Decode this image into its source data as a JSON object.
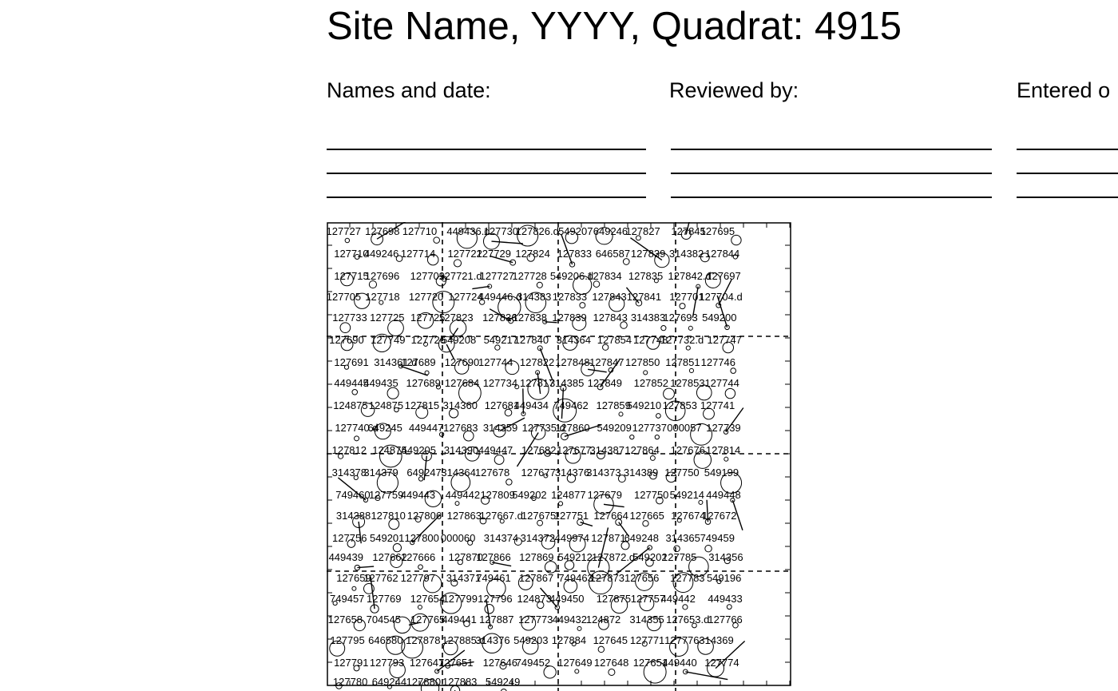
{
  "header": {
    "title": "Site Name, YYYY, Quadrat: 4915"
  },
  "signoff": {
    "names_label": "Names and date:",
    "reviewed_label": "Reviewed by:",
    "entered_label": "Entered o"
  },
  "map": {
    "stroke_color": "#000000",
    "grid": "dashed",
    "labels": [
      "127727",
      "127698",
      "127710",
      "449436.d",
      "127730",
      "127826.d",
      "549207",
      "649246",
      "127827",
      "127845",
      "127695",
      "127710",
      "449246",
      "127714",
      "127722",
      "127729",
      "127824",
      "127833",
      "646587",
      "127839",
      "314382",
      "127844",
      "127715",
      "127696",
      "127709",
      "127721.d",
      "127727",
      "127728",
      "549206.d",
      "127834",
      "127835",
      "127842.d",
      "127697",
      "127705",
      "127718",
      "127720",
      "127724",
      "449446.d",
      "314383",
      "127833",
      "127843",
      "127841",
      "127701",
      "127704.d",
      "127733",
      "127725",
      "127725",
      "127823",
      "127836",
      "127838",
      "127839",
      "127843",
      "314383",
      "127693",
      "549200",
      "127690",
      "127749",
      "127726",
      "549208",
      "549217",
      "127840",
      "314364",
      "127854",
      "127748",
      "127732.d",
      "127747",
      "127691",
      "314361.d",
      "127689",
      "127690",
      "127744",
      "127822",
      "127848",
      "127847",
      "127850",
      "127851",
      "127746",
      "449445",
      "449435",
      "127689",
      "127684",
      "127734",
      "127817",
      "314385",
      "127849",
      "127852",
      "127853",
      "127744",
      "124875",
      "124875",
      "127815",
      "314360",
      "127681",
      "449434",
      "749462",
      "127859",
      "549210",
      "127853",
      "127741",
      "127740.d",
      "649245",
      "449447",
      "127683",
      "314359",
      "127735.d",
      "127860",
      "549209",
      "127737",
      "000057",
      "127739",
      "127812",
      "124874",
      "549205",
      "314390",
      "449447",
      "127682",
      "127677",
      "314387",
      "127864",
      "127676",
      "127814",
      "314378",
      "314379",
      "649247",
      "314364",
      "127678",
      "127677",
      "314376",
      "314373",
      "314389",
      "127750",
      "549199",
      "749460",
      "127759",
      "449443",
      "449442",
      "127809",
      "549202",
      "124877",
      "127679",
      "127750",
      "549214",
      "449448",
      "314388",
      "127810",
      "127806",
      "127863",
      "127667.d",
      "127675",
      "127751",
      "127664",
      "127665",
      "127674",
      "127672",
      "127756",
      "549201",
      "127800",
      "000060",
      "314374",
      "314372",
      "449974",
      "127871",
      "649248",
      "314365",
      "749459",
      "449439",
      "127662",
      "127666",
      "127870",
      "127866",
      "127869",
      "549212",
      "127872.d",
      "549202",
      "127785",
      "314356",
      "127659",
      "127762",
      "127797",
      "314371",
      "749461",
      "127867",
      "749463",
      "127873",
      "127656",
      "127783",
      "549196",
      "749457",
      "127769",
      "127654",
      "127799",
      "127796",
      "124873",
      "449450",
      "127875",
      "127757",
      "449442",
      "449433",
      "127658",
      "704545",
      "127765",
      "449441",
      "127887",
      "127773",
      "449432",
      "124872",
      "314355",
      "127653.d",
      "127766",
      "127795",
      "646580",
      "127878",
      "127885.d",
      "314376",
      "549203",
      "127884",
      "127645",
      "127771",
      "127776",
      "314369",
      "127791",
      "127793",
      "127647",
      "127651",
      "127646",
      "749452",
      "127649",
      "127648",
      "127651",
      "449440",
      "127774",
      "127780",
      "649244",
      "127880",
      "127883",
      "549249"
    ]
  }
}
